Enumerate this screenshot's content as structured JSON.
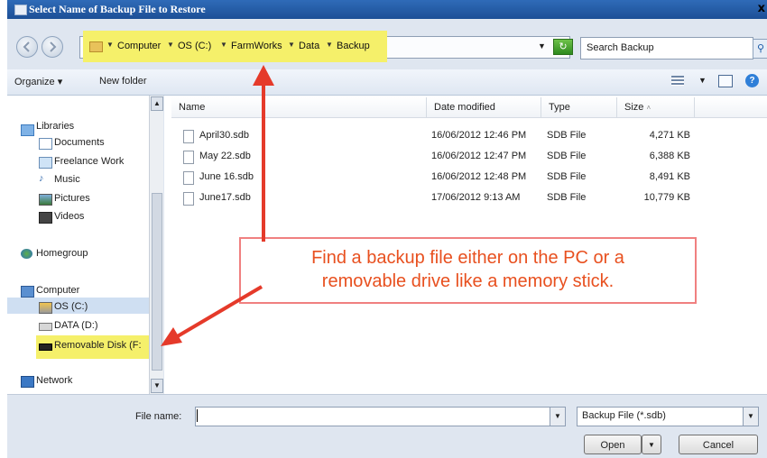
{
  "window": {
    "title": "Select Name of Backup File to Restore",
    "close_glyph": "x"
  },
  "address_bar": {
    "breadcrumbs": [
      "Computer",
      "OS (C:)",
      "FarmWorks",
      "Data",
      "Backup"
    ],
    "search_placeholder": "Search Backup"
  },
  "toolbar": {
    "organize_label": "Organize",
    "new_folder_label": "New folder",
    "help_glyph": "?"
  },
  "nav_pane": {
    "libraries": "Libraries",
    "documents": "Documents",
    "freelance": "Freelance Work",
    "music": "Music",
    "pictures": "Pictures",
    "videos": "Videos",
    "homegroup": "Homegroup",
    "computer": "Computer",
    "os_drive": "OS (C:)",
    "data_drive": "DATA (D:)",
    "removable": "Removable Disk (F:",
    "network": "Network"
  },
  "file_list": {
    "columns": {
      "name": "Name",
      "date": "Date modified",
      "type": "Type",
      "size": "Size"
    },
    "rows": [
      {
        "name": "April30.sdb",
        "date": "16/06/2012 12:46 PM",
        "type": "SDB File",
        "size": "4,271 KB"
      },
      {
        "name": "May 22.sdb",
        "date": "16/06/2012 12:47 PM",
        "type": "SDB File",
        "size": "6,388 KB"
      },
      {
        "name": "June 16.sdb",
        "date": "16/06/2012 12:48 PM",
        "type": "SDB File",
        "size": "8,491 KB"
      },
      {
        "name": "June17.sdb",
        "date": "17/06/2012 9:13 AM",
        "type": "SDB File",
        "size": "10,779 KB"
      }
    ]
  },
  "bottom": {
    "file_name_label": "File name:",
    "file_name_value": "",
    "file_type_value": "Backup File (*.sdb)",
    "open_label": "Open",
    "cancel_label": "Cancel"
  },
  "callout": {
    "line1": "Find a backup file either on the PC or a",
    "line2": "removable drive like a memory stick."
  },
  "colors": {
    "highlight_yellow": "#f5f06a",
    "arrow_red": "#e53a2a",
    "callout_text": "#e8501f",
    "titlebar_blue": "#1c4f96"
  },
  "icons": {
    "back": "back-arrow-icon",
    "forward": "forward-arrow-icon",
    "refresh": "refresh-icon",
    "search": "search-icon",
    "help": "help-icon"
  }
}
